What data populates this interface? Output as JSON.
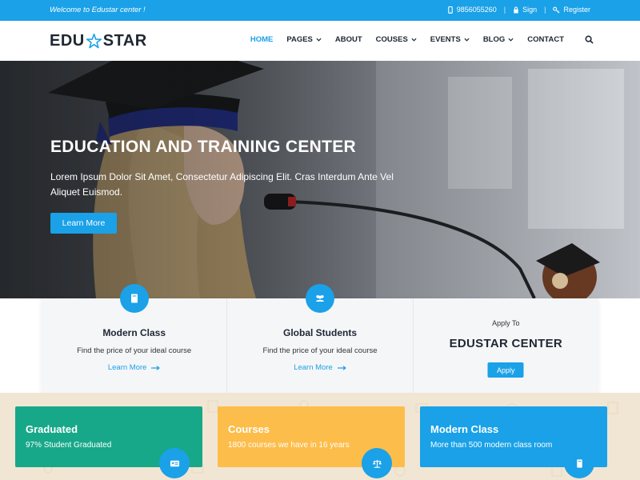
{
  "topbar": {
    "welcome": "Welcome to Edustar center !",
    "phone": "9856055260",
    "sign": "Sign",
    "register": "Register"
  },
  "header": {
    "logo_left": "EDU",
    "logo_right": "STAR",
    "nav": [
      {
        "label": "HOME",
        "active": true
      },
      {
        "label": "PAGES",
        "dropdown": true
      },
      {
        "label": "ABOUT"
      },
      {
        "label": "COUSES",
        "dropdown": true
      },
      {
        "label": "EVENTS",
        "dropdown": true
      },
      {
        "label": "BLOG",
        "dropdown": true
      },
      {
        "label": "CONTACT"
      }
    ]
  },
  "hero": {
    "title": "EDUCATION AND TRAINING CENTER",
    "text": "Lorem Ipsum Dolor Sit Amet, Consectetur Adipiscing Elit. Cras Interdum Ante Vel Aliquet Euismod.",
    "button": "Learn More"
  },
  "features": [
    {
      "icon": "book-icon",
      "title": "Modern Class",
      "desc": "Find the price of your ideal course",
      "link": "Learn More"
    },
    {
      "icon": "users-icon",
      "title": "Global Students",
      "desc": "Find the price of your ideal course",
      "link": "Learn More"
    }
  ],
  "apply": {
    "label": "Apply To",
    "title": "EDUSTAR CENTER",
    "button": "Apply"
  },
  "stats": [
    {
      "title": "Graduated",
      "text": "97% Student Graduated",
      "color": "#17a889",
      "icon": "id-card-icon"
    },
    {
      "title": "Courses",
      "text": "1800 courses we have in 16 years",
      "color": "#fdbd4a",
      "icon": "scale-icon"
    },
    {
      "title": "Modern Class",
      "text": "More than 500 modern class room",
      "color": "#1aa1e8",
      "icon": "book-icon"
    }
  ],
  "colors": {
    "accent": "#1aa1e8",
    "dark": "#1e2733"
  }
}
